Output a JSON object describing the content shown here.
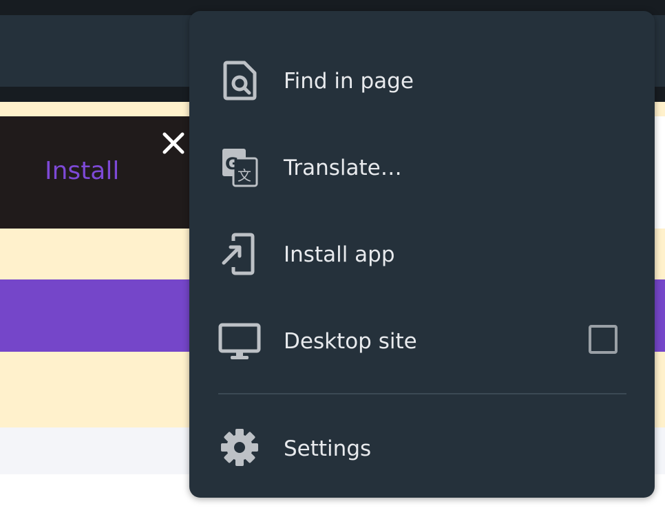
{
  "banner": {
    "install_label": "Install"
  },
  "menu": {
    "items": [
      {
        "label": "Find in page",
        "icon": "find-in-page-icon"
      },
      {
        "label": "Translate…",
        "icon": "translate-icon"
      },
      {
        "label": "Install app",
        "icon": "install-app-icon"
      },
      {
        "label": "Desktop site",
        "icon": "desktop-icon",
        "checked": false
      },
      {
        "label": "Settings",
        "icon": "gear-icon"
      }
    ]
  },
  "colors": {
    "menu_bg": "#25313b",
    "menu_text": "#e8eaed",
    "icon": "#bdc1c6",
    "accent_purple": "#7546c9",
    "banner_bg": "#201b1b",
    "cream": "#fff1cc"
  }
}
